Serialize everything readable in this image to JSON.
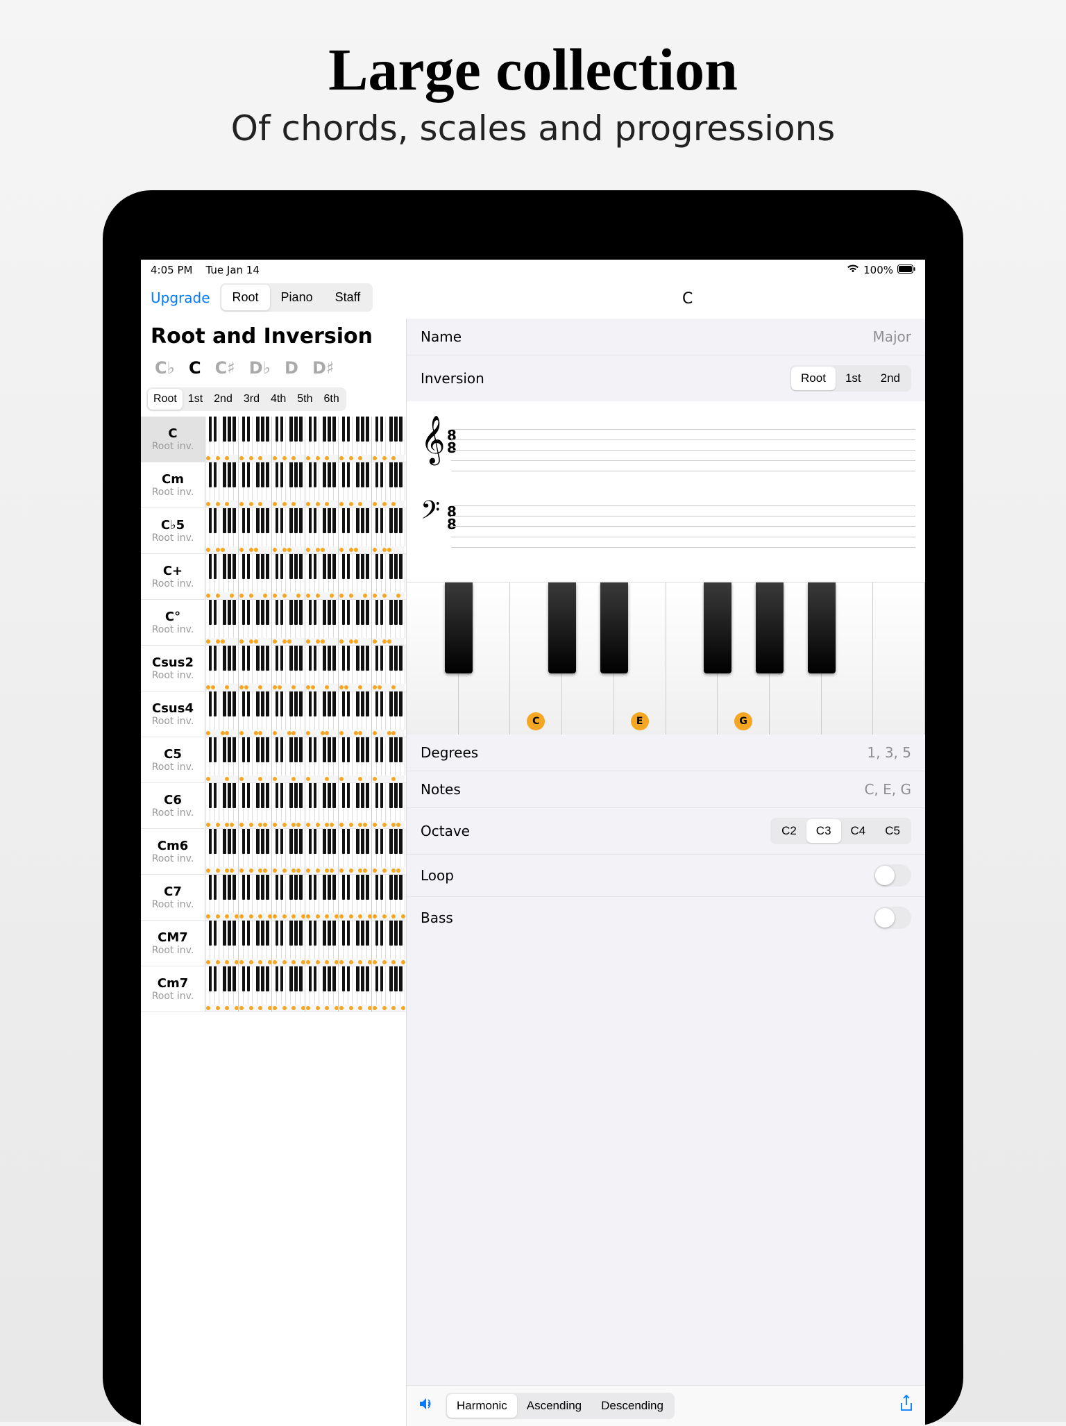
{
  "marketing": {
    "title": "Large collection",
    "subtitle": "Of chords, scales and progressions"
  },
  "status": {
    "time": "4:05 PM",
    "date": "Tue Jan 14",
    "battery": "100%"
  },
  "toolbar": {
    "upgrade": "Upgrade",
    "tabs": [
      "Root",
      "Piano",
      "Staff"
    ],
    "active_tab": "Root",
    "header_chord": "C"
  },
  "left": {
    "title": "Root and Inversion",
    "notes": [
      "C♭",
      "C",
      "C♯",
      "D♭",
      "D",
      "D♯"
    ],
    "selected_note": "C",
    "inversions": [
      "Root",
      "1st",
      "2nd",
      "3rd",
      "4th",
      "5th",
      "6th"
    ],
    "selected_inv": "Root",
    "chords": [
      {
        "name": "C",
        "inv": "Root inv.",
        "sel": true,
        "dots": [
          [
            0,
            2,
            4
          ]
        ]
      },
      {
        "name": "Cm",
        "inv": "Root inv.",
        "dots": [
          [
            0,
            2,
            4
          ]
        ]
      },
      {
        "name": "C♭5",
        "inv": "Root inv.",
        "dots": [
          [
            0,
            2,
            3
          ]
        ]
      },
      {
        "name": "C+",
        "inv": "Root inv.",
        "dots": [
          [
            0,
            2,
            5
          ]
        ]
      },
      {
        "name": "C°",
        "inv": "Root inv.",
        "dots": [
          [
            0,
            2,
            3
          ]
        ]
      },
      {
        "name": "Csus2",
        "inv": "Root inv.",
        "dots": [
          [
            0,
            1,
            4
          ]
        ]
      },
      {
        "name": "Csus4",
        "inv": "Root inv.",
        "dots": [
          [
            0,
            3,
            4
          ]
        ]
      },
      {
        "name": "C5",
        "inv": "Root inv.",
        "dots": [
          [
            0,
            4
          ]
        ]
      },
      {
        "name": "C6",
        "inv": "Root inv.",
        "dots": [
          [
            0,
            2,
            4,
            5
          ]
        ]
      },
      {
        "name": "Cm6",
        "inv": "Root inv.",
        "dots": [
          [
            0,
            2,
            4,
            5
          ]
        ]
      },
      {
        "name": "C7",
        "inv": "Root inv.",
        "dots": [
          [
            0,
            2,
            4,
            6
          ]
        ]
      },
      {
        "name": "CM7",
        "inv": "Root inv.",
        "dots": [
          [
            0,
            2,
            4,
            6
          ]
        ]
      },
      {
        "name": "Cm7",
        "inv": "Root inv.",
        "dots": [
          [
            0,
            2,
            4,
            6
          ]
        ]
      }
    ]
  },
  "right": {
    "name_label": "Name",
    "name_value": "Major",
    "inv_label": "Inversion",
    "inv_options": [
      "Root",
      "1st",
      "2nd"
    ],
    "inv_selected": "Root",
    "degrees_label": "Degrees",
    "degrees_value": "1, 3, 5",
    "notes_label": "Notes",
    "notes_value": "C, E, G",
    "octave_label": "Octave",
    "octave_options": [
      "C2",
      "C3",
      "C4",
      "C5"
    ],
    "octave_selected": "C3",
    "loop_label": "Loop",
    "bass_label": "Bass",
    "marked_notes": [
      "C",
      "E",
      "G"
    ],
    "play_modes": [
      "Harmonic",
      "Ascending",
      "Descending"
    ],
    "play_selected": "Harmonic"
  }
}
